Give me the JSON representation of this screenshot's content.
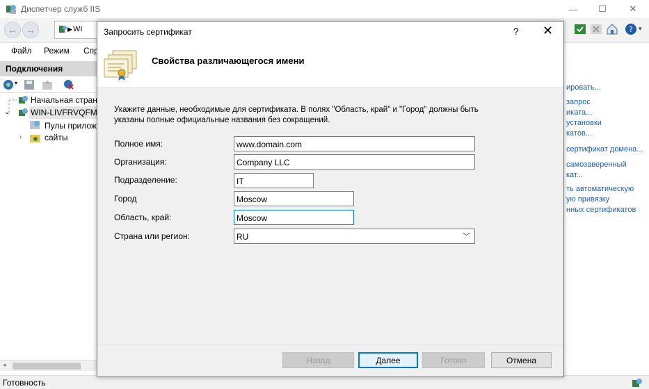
{
  "window": {
    "title": "Диспетчер служб IIS"
  },
  "nav": {
    "address": "WI"
  },
  "menu": [
    "Файл",
    "Режим",
    "Спр"
  ],
  "connections": {
    "header": "Подключения",
    "tree": [
      "Начальная стран",
      "WIN-LIVFRVQFMK",
      "Пулы прилож",
      "сайты"
    ]
  },
  "actions": [
    "ировать...",
    "запрос",
    "иката...",
    "установки",
    "катов...",
    "сертификат домена...",
    "самозаверенный",
    "кат...",
    "ть автоматическую",
    "ую привязку",
    "нных сертификатов"
  ],
  "status": {
    "text": "Готовность"
  },
  "dialog": {
    "title": "Запросить сертификат",
    "help": "?",
    "close": "✕",
    "heading": "Свойства различающегося имени",
    "description": "Укажите данные, необходимые для сертификата. В полях \"Область, край\" и \"Город\" должны быть указаны полные официальные названия без сокращений.",
    "fields": {
      "full_name": {
        "label": "Полное имя:",
        "value": "www.domain.com"
      },
      "organization": {
        "label": "Организация:",
        "value": "Company LLC"
      },
      "department": {
        "label": "Подразделение:",
        "value": "IT"
      },
      "city": {
        "label": "Город",
        "value": "Moscow"
      },
      "region": {
        "label": "Область, край:",
        "value": "Moscow"
      },
      "country": {
        "label": "Страна или регион:",
        "value": "RU"
      }
    },
    "buttons": {
      "back": "Назад",
      "next": "Далее",
      "finish": "Готово",
      "cancel": "Отмена"
    }
  }
}
